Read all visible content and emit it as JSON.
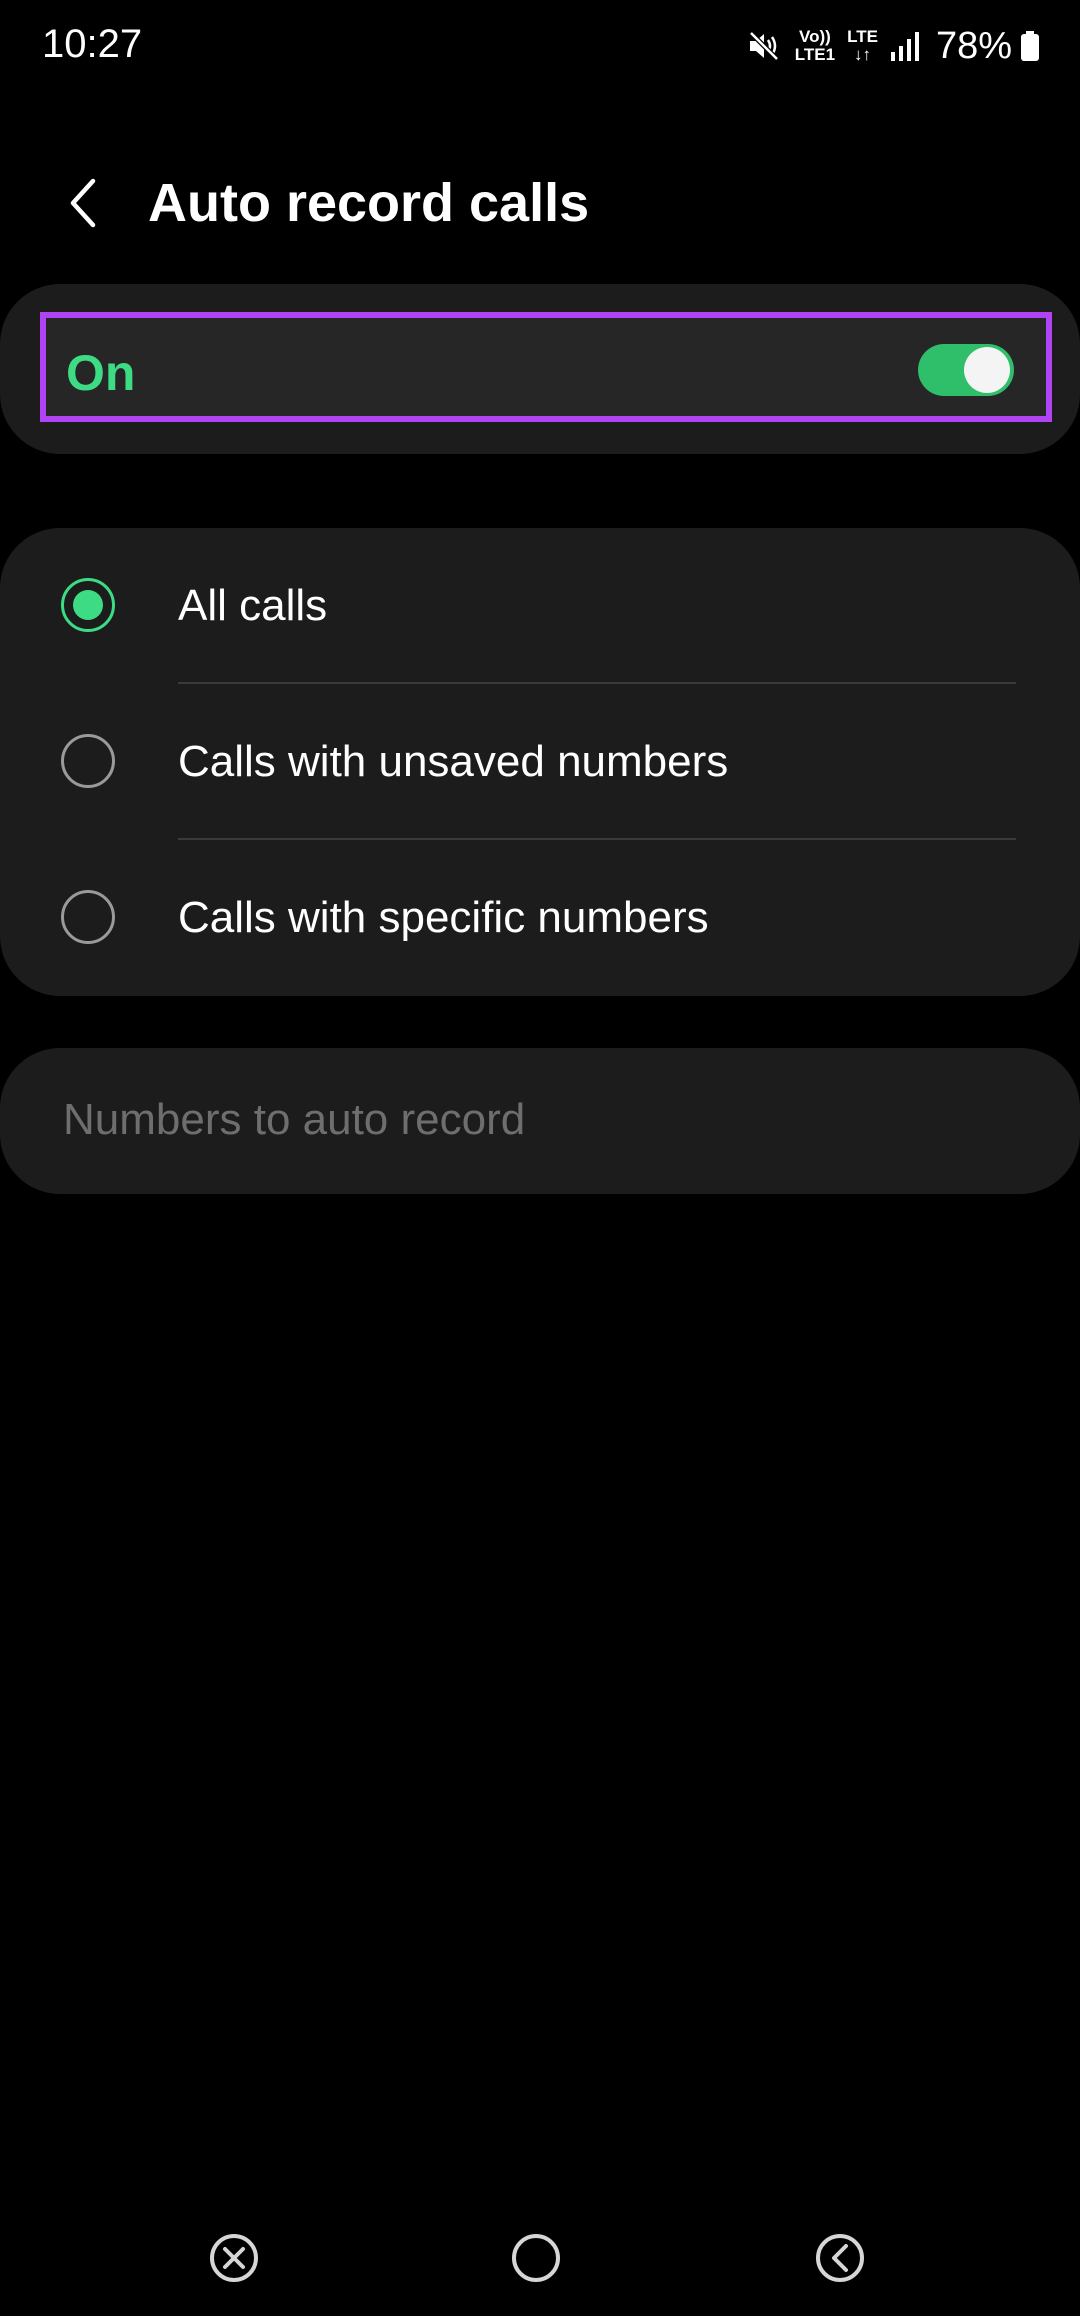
{
  "status_bar": {
    "time": "10:27",
    "volte_top": "Vo))",
    "volte_bottom": "LTE1",
    "lte_top": "LTE",
    "lte_bottom": "↓↑",
    "battery_percent": "78%",
    "icons": [
      "mute-icon",
      "volte-icon",
      "lte-icon",
      "signal-icon",
      "battery-icon"
    ]
  },
  "header": {
    "title": "Auto record calls",
    "back_icon": "chevron-left-icon"
  },
  "master_switch": {
    "label": "On",
    "enabled": true,
    "accent_color": "#3ddc84",
    "highlight_color": "#b044f5"
  },
  "options": [
    {
      "label": "All calls",
      "selected": true
    },
    {
      "label": "Calls with unsaved numbers",
      "selected": false
    },
    {
      "label": "Calls with specific numbers",
      "selected": false
    }
  ],
  "numbers_to_record": {
    "label": "Numbers to auto record",
    "enabled": false
  },
  "nav_bar": {
    "icons": [
      "recents-icon",
      "home-icon",
      "back-icon"
    ]
  }
}
